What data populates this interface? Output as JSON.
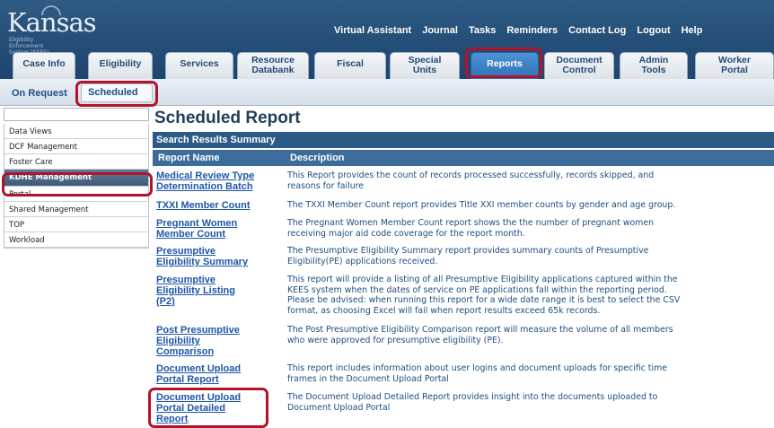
{
  "logo": {
    "word": "Kansas",
    "tagline": "Eligibility Enforcement System (KEES)"
  },
  "topnav": [
    "Virtual Assistant",
    "Journal",
    "Tasks",
    "Reminders",
    "Contact Log",
    "Logout",
    "Help"
  ],
  "tabs": [
    {
      "line1": "Case Info",
      "line2": ""
    },
    {
      "line1": "Eligibility",
      "line2": ""
    },
    {
      "line1": "Services",
      "line2": ""
    },
    {
      "line1": "Resource",
      "line2": "Databank"
    },
    {
      "line1": "Fiscal",
      "line2": ""
    },
    {
      "line1": "Special",
      "line2": "Units"
    },
    {
      "line1": "Reports",
      "line2": ""
    },
    {
      "line1": "Document",
      "line2": "Control"
    },
    {
      "line1": "Admin",
      "line2": "Tools"
    },
    {
      "line1": "Worker",
      "line2": "Portal"
    }
  ],
  "subnav": {
    "on_request": "On Request",
    "scheduled": "Scheduled"
  },
  "sidebar": {
    "items": [
      {
        "label": "Data Views"
      },
      {
        "label": "DCF Management"
      },
      {
        "label": "Foster Care"
      },
      {
        "label": "KDHE Management"
      },
      {
        "label": "Portal"
      },
      {
        "label": "Shared Management"
      },
      {
        "label": "TOP"
      },
      {
        "label": "Workload"
      }
    ]
  },
  "main": {
    "title": "Scheduled Report",
    "results_label": "Search Results Summary",
    "col_name": "Report Name",
    "col_desc": "Description",
    "reports": [
      {
        "name": [
          "Medical Review Type",
          "Determination Batch"
        ],
        "desc": [
          "This Report provides the count of records processed successfully, records skipped, and",
          "reasons for failure"
        ]
      },
      {
        "name": [
          "TXXI Member Count"
        ],
        "desc": [
          "The TXXI Member Count report provides Title XXI member counts by gender and age group."
        ]
      },
      {
        "name": [
          "Pregnant Women",
          "Member Count"
        ],
        "desc": [
          "The Pregnant Women Member Count report shows the the number of pregnant women",
          "receiving major aid code coverage for the report month."
        ]
      },
      {
        "name": [
          "Presumptive",
          "Eligibility Summary"
        ],
        "desc": [
          "The Presumptive Eligibility Summary report provides summary counts of Presumptive",
          "Eligibility(PE) applications received."
        ]
      },
      {
        "name": [
          "Presumptive",
          "Eligibility Listing",
          "(P2)"
        ],
        "desc": [
          "This report will provide a listing of all Presumptive Eligibility applications captured within the",
          "KEES system when the dates of service on PE applications fall within the reporting period.",
          "Please be advised: when running this report for a wide date range it is best to select the CSV",
          "format, as choosing Excel will fail when report results exceed 65k records."
        ]
      },
      {
        "name": [
          "Post Presumptive",
          "Eligibility",
          "Comparison"
        ],
        "desc": [
          "The Post Presumptive Eligibility Comparison report will measure the volume of all members",
          "who were approved for presumptive eligibility (PE)."
        ]
      },
      {
        "name": [
          "Document Upload",
          "Portal Report"
        ],
        "desc": [
          "This report includes information about user logins and document uploads for specific time",
          "frames in the Document Upload Portal"
        ]
      },
      {
        "name": [
          "Document Upload",
          "Portal Detailed",
          "Report"
        ],
        "desc": [
          "The Document Upload Detailed Report provides insight into the documents uploaded to",
          "Document Upload Portal"
        ]
      }
    ]
  },
  "colors": {
    "header": "#244e77",
    "active_tab": "#3a7fc4",
    "highlight": "#b3122b",
    "link": "#1f56a8"
  }
}
